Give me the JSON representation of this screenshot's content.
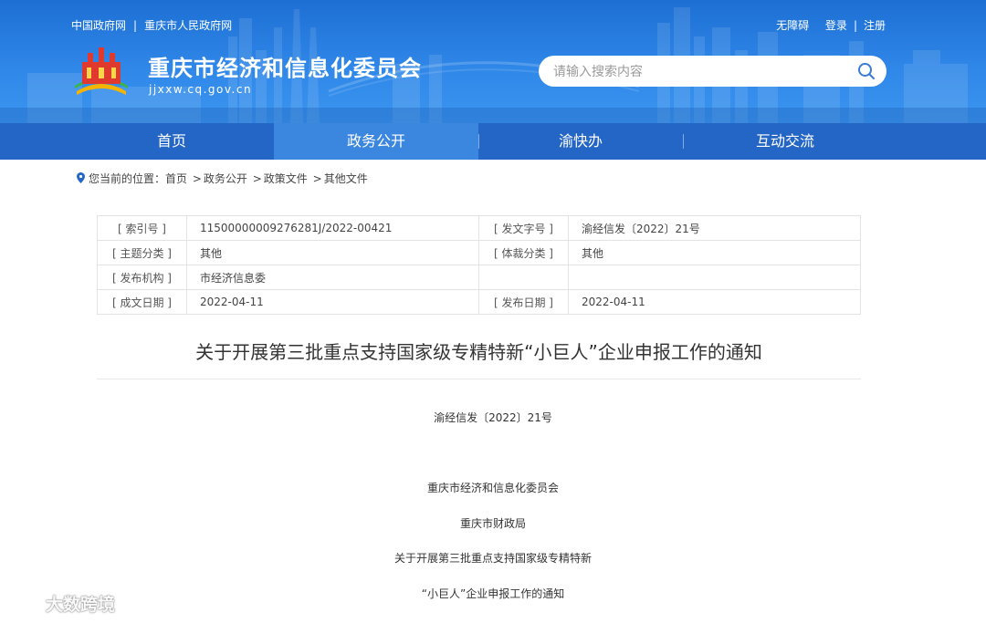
{
  "header": {
    "top_links": [
      "中国政府网",
      "重庆市人民政府网"
    ],
    "user_links": [
      "无障碍",
      "登录",
      "注册"
    ],
    "site_title": "重庆市经济和信息化委员会",
    "site_url": "jjxxw.cq.gov.cn",
    "search_placeholder": "请输入搜索内容"
  },
  "nav": {
    "items": [
      "首页",
      "政务公开",
      "渝快办",
      "互动交流"
    ],
    "active": "政务公开"
  },
  "breadcrumb": {
    "label": "您当前的位置：",
    "items": [
      "首页",
      "政务公开",
      "政策文件",
      "其他文件"
    ]
  },
  "meta": {
    "index_key": "[ 索引号 ]",
    "index_val": "11500000009276281J/2022-00421",
    "docno_key": "[ 发文字号 ]",
    "docno_val": "渝经信发〔2022〕21号",
    "topic_key": "[ 主题分类 ]",
    "topic_val": "其他",
    "genre_key": "[ 体裁分类 ]",
    "genre_val": "其他",
    "org_key": "[ 发布机构 ]",
    "org_val": "市经济信息委",
    "made_key": "[ 成文日期 ]",
    "made_val": "2022-04-11",
    "pub_key": "[ 发布日期 ]",
    "pub_val": "2022-04-11"
  },
  "article": {
    "title": "关于开展第三批重点支持国家级专精特新“小巨人”企业申报工作的通知",
    "doc_number": "渝经信发〔2022〕21号",
    "issuer1": "重庆市经济和信息化委员会",
    "issuer2": "重庆市财政局",
    "line1": "关于开展第三批重点支持国家级专精特新",
    "line2": "“小巨人”企业申报工作的通知"
  },
  "watermark": "大数跨境",
  "colors": {
    "banner": "#2f87e8",
    "nav": "#2466c6",
    "nav_active": "#3b86de"
  }
}
